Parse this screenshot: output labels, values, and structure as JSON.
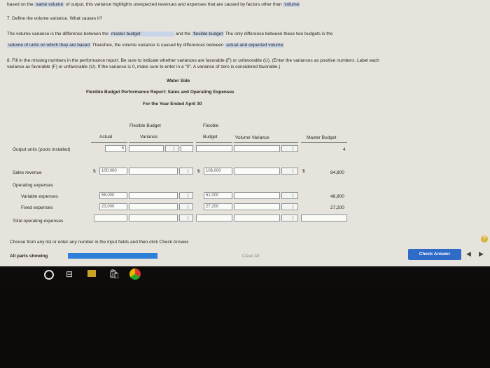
{
  "top_text": {
    "prefix": "based on the",
    "same_volume": "same volume",
    "middle": "of output, this variance highlights unexpected revenues and expenses that are caused by factors other than",
    "volume": "volume"
  },
  "question7": {
    "label": "7. Define the volume variance. What causes it?",
    "line1_a": "The volume variance is the difference between the",
    "dropdown1": "master budget",
    "line1_b": "and the",
    "dropdown2": "flexible budget",
    "line1_c": "The only difference between these two budgets is the",
    "dropdown3": "volume of units on which they are based",
    "line2_b": "Therefore, the volume variance is caused by differences between",
    "dropdown4": "actual and expected volume"
  },
  "question8": {
    "line1": "8. Fill in the missing numbers in the performance report. Be sure to indicate whether variances are favorable (F) or unfavorable (U). (Enter the variances as positive numbers. Label each",
    "line2": "variance as favorable (F) or unfavorable (U). If the variance is 0, make sure to enter in a \"0\". A variance of zero is considered favorable.)"
  },
  "report": {
    "company": "Water Side",
    "title": "Flexible Budget Performance Report: Sales and Operating Expenses",
    "period": "For the Year Ended April 30",
    "headers": {
      "actual": "Actual",
      "flex_var_1": "Flexible Budget",
      "flex_var_2": "Variance",
      "flex_1": "Flexible",
      "flex_2": "Budget",
      "vol_var": "Volume Variance",
      "master": "Master Budget"
    },
    "rows": {
      "output_label": "Output units (pools installed)",
      "output_actual": "5",
      "output_master": "4",
      "sales_label": "Sales revenue",
      "dollar": "$",
      "sales_actual": "100,000",
      "sales_flex": "106,000",
      "sales_master": "84,800",
      "opex_label": "Operating expenses",
      "var_label": "Variable expenses",
      "var_actual": "58,000",
      "var_flex": "61,000",
      "var_master": "48,800",
      "fixed_label": "Fixed expenses",
      "fixed_actual": "23,000",
      "fixed_flex": "27,200",
      "fixed_master": "27,200",
      "total_label": "Total operating expenses"
    }
  },
  "footer": {
    "hint": "Choose from any list or enter any number in the input fields and then click Check Answer.",
    "all_parts": "All parts showing",
    "clear_all": "Clear All",
    "check_answer": "Check Answer",
    "help": "?"
  },
  "colors": {
    "check_button": "#2f6bc9",
    "progress": "#2d7fd8",
    "highlight": "#c7d3e6"
  }
}
